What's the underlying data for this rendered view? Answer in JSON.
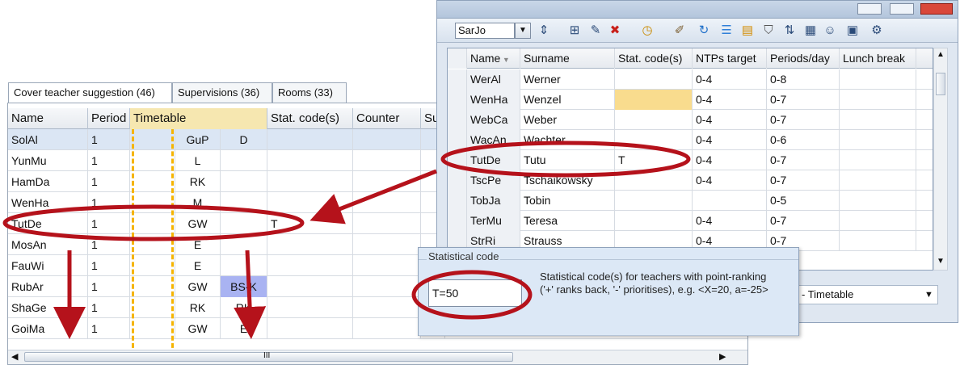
{
  "left_tabs": [
    "Cover teacher suggestion (46)",
    "Supervisions (36)",
    "Rooms (33)"
  ],
  "left_columns": [
    "Name",
    "Period",
    "Timetable",
    "Stat. code(s)",
    "Counter",
    "Su"
  ],
  "left_rows": [
    {
      "name": "SolAl",
      "period": "1",
      "tt1": "",
      "tt2": "GuP",
      "tt3": "D",
      "stat": "",
      "selected": true
    },
    {
      "name": "YunMu",
      "period": "1",
      "tt1": "",
      "tt2": "L",
      "tt3": "",
      "stat": ""
    },
    {
      "name": "HamDa",
      "period": "1",
      "tt1": "",
      "tt2": "RK",
      "tt3": "",
      "stat": ""
    },
    {
      "name": "WenHa",
      "period": "1",
      "tt1": "",
      "tt2": "M",
      "tt3": "",
      "stat": ""
    },
    {
      "name": "TutDe",
      "period": "1",
      "tt1": "",
      "tt2": "GW",
      "tt3": "",
      "stat": "T"
    },
    {
      "name": "MosAn",
      "period": "1",
      "tt1": "",
      "tt2": "E",
      "tt3": "",
      "stat": ""
    },
    {
      "name": "FauWi",
      "period": "1",
      "tt1": "",
      "tt2": "E",
      "tt3": "",
      "stat": ""
    },
    {
      "name": "RubAr",
      "period": "1",
      "tt1": "",
      "tt2": "GW",
      "tt3": "BS-K",
      "stat": "",
      "tt3_highlight": true
    },
    {
      "name": "ShaGe",
      "period": "1",
      "tt1": "",
      "tt2": "RK",
      "tt3": "RK",
      "stat": ""
    },
    {
      "name": "GoiMa",
      "period": "1",
      "tt1": "",
      "tt2": "GW",
      "tt3": "E",
      "stat": ""
    }
  ],
  "left_scroll_label": "III",
  "right_window": {
    "teacher_select": "SarJo",
    "toolbar_icons": [
      "spin-arrows-icon",
      "new-grid-icon",
      "new-item-icon",
      "delete-icon",
      "clock-icon",
      "pencil-icon",
      "refresh-icon",
      "list-icon",
      "report-icon",
      "filter-icon",
      "sort-icon",
      "table-icon",
      "people-icon",
      "calendar-icon",
      "settings-icon"
    ],
    "columns": [
      "Name",
      "Surname",
      "Stat. code(s)",
      "NTPs target",
      "Periods/day",
      "Lunch break"
    ],
    "rows": [
      {
        "name": "WerAl",
        "surname": "Werner",
        "stat": "",
        "ntp": "0-4",
        "ppd": "0-8"
      },
      {
        "name": "WenHa",
        "surname": "Wenzel",
        "stat": "",
        "ntp": "0-4",
        "ppd": "0-7",
        "stat_highlight": true
      },
      {
        "name": "WebCa",
        "surname": "Weber",
        "stat": "",
        "ntp": "0-4",
        "ppd": "0-7"
      },
      {
        "name": "WacAn",
        "surname": "Wachter",
        "stat": "",
        "ntp": "0-4",
        "ppd": "0-6"
      },
      {
        "name": "TutDe",
        "surname": "Tutu",
        "stat": "T",
        "ntp": "0-4",
        "ppd": "0-7"
      },
      {
        "name": "TscPe",
        "surname": "Tschaikowsky",
        "stat": "",
        "ntp": "0-4",
        "ppd": "0-7"
      },
      {
        "name": "TobJa",
        "surname": "Tobin",
        "stat": "",
        "ntp": "",
        "ppd": "0-5"
      },
      {
        "name": "TerMu",
        "surname": "Teresa",
        "stat": "",
        "ntp": "0-4",
        "ppd": "0-7"
      },
      {
        "name": "StrRi",
        "surname": "Strauss",
        "stat": "",
        "ntp": "0-4",
        "ppd": "0-7"
      }
    ],
    "bottom_combo": "- Timetable"
  },
  "stat_popup": {
    "title": "Statistical code",
    "input_value": "T=50",
    "description": "Statistical code(s) for teachers with point-ranking  ('+' ranks back, '-' prioritises), e.g. <X=20, a=-25>"
  },
  "colors": {
    "annotation_red": "#b5121b",
    "selection_blue": "#dbe6f4",
    "highlight_yellow": "#f9dc8e",
    "highlight_purple": "#a9b3f2",
    "timetable_dash": "#f5b400"
  }
}
